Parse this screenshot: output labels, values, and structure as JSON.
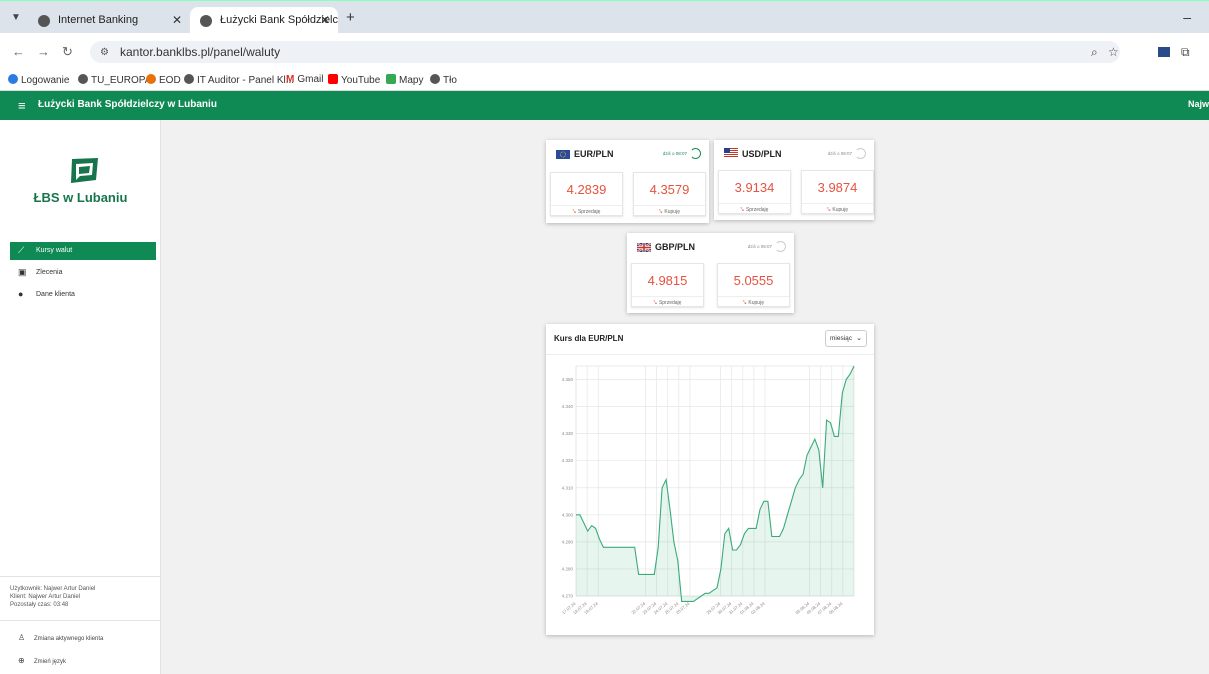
{
  "browser": {
    "tabs": [
      {
        "label": "Internet Banking"
      },
      {
        "label": "Łużycki Bank Spółdzielczy w Lub"
      }
    ],
    "url": "kantor.banklbs.pl/panel/waluty",
    "bookmarks": [
      {
        "label": "Logowanie",
        "color": "#2a7be4"
      },
      {
        "label": "TU_EUROPA",
        "color": "#555555"
      },
      {
        "label": "EOD",
        "color": "#e8710a"
      },
      {
        "label": "IT Auditor - Panel Kl...",
        "color": "#555555"
      },
      {
        "label": "Gmail",
        "color": "#d93025"
      },
      {
        "label": "YouTube",
        "color": "#ff0000"
      },
      {
        "label": "Mapy",
        "color": "#34a853"
      },
      {
        "label": "Tło",
        "color": "#555555"
      }
    ]
  },
  "app": {
    "title": "Łużycki Bank Spółdzielczy w Lubaniu",
    "user_short": "Najw",
    "brand_color": "#108a55",
    "logo_text": "ŁBS w Lubaniu"
  },
  "sidebar": {
    "menu": [
      {
        "label": "Kursy walut",
        "icon": "trending-icon",
        "active": true
      },
      {
        "label": "Zlecenia",
        "icon": "clipboard-icon",
        "active": false
      },
      {
        "label": "Dane klienta",
        "icon": "person-icon",
        "active": false
      }
    ],
    "user_line": "Użytkownik: Najwer Artur Daniel",
    "client_line": "Klient: Najwer Artur Daniel",
    "time_line": "Pozostały czas: 03:48",
    "change_client": "Zmiana aktywnego klienta",
    "change_language": "Zmień język"
  },
  "rates": [
    {
      "pair": "EUR/PLN",
      "updated": "dziś o 08:07",
      "sell": "4.2839",
      "buy": "4.3579",
      "flag": "eu",
      "active": true
    },
    {
      "pair": "USD/PLN",
      "updated": "dziś o 08:07",
      "sell": "3.9134",
      "buy": "3.9874",
      "flag": "us",
      "active": false
    },
    {
      "pair": "GBP/PLN",
      "updated": "dziś o 08:07",
      "sell": "4.9815",
      "buy": "5.0555",
      "flag": "gb",
      "active": false
    }
  ],
  "rate_labels": {
    "sell": "Sprzedaję",
    "buy": "Kupuję"
  },
  "chart": {
    "title": "Kurs dla EUR/PLN",
    "range_select": "miesiąc"
  },
  "chart_data": {
    "type": "area",
    "ylim": [
      4.27,
      4.355
    ],
    "y_ticks": [
      "4.270",
      "4.280",
      "4.290",
      "4.300",
      "4.310",
      "4.320",
      "4.330",
      "4.340",
      "4.350"
    ],
    "x_ticks": [
      "17.07.24",
      "18.07.24",
      "19.07.24",
      "22.07.24",
      "23.07.24",
      "24.07.24",
      "25.07.24",
      "26.07.24",
      "29.07.24",
      "30.07.24",
      "31.07.24",
      "01.08.24",
      "02.08.24",
      "05.08.24",
      "06.08.24",
      "07.08.24",
      "08.08.24"
    ],
    "series": [
      {
        "color": "#3aaa78",
        "values": [
          4.3,
          4.3,
          4.297,
          4.294,
          4.296,
          4.295,
          4.291,
          4.288,
          4.288,
          4.288,
          4.288,
          4.288,
          4.288,
          4.288,
          4.288,
          4.288,
          4.278,
          4.278,
          4.278,
          4.278,
          4.278,
          4.288,
          4.31,
          4.313,
          4.302,
          4.29,
          4.283,
          4.268,
          4.268,
          4.268,
          4.268,
          4.269,
          4.27,
          4.271,
          4.271,
          4.272,
          4.273,
          4.28,
          4.293,
          4.295,
          4.287,
          4.287,
          4.289,
          4.293,
          4.295,
          4.295,
          4.295,
          4.302,
          4.305,
          4.305,
          4.292,
          4.292,
          4.292,
          4.295,
          4.3,
          4.305,
          4.31,
          4.313,
          4.315,
          4.322,
          4.325,
          4.328,
          4.324,
          4.31,
          4.335,
          4.334,
          4.329,
          4.329,
          4.345,
          4.35,
          4.352,
          4.355
        ]
      }
    ]
  }
}
